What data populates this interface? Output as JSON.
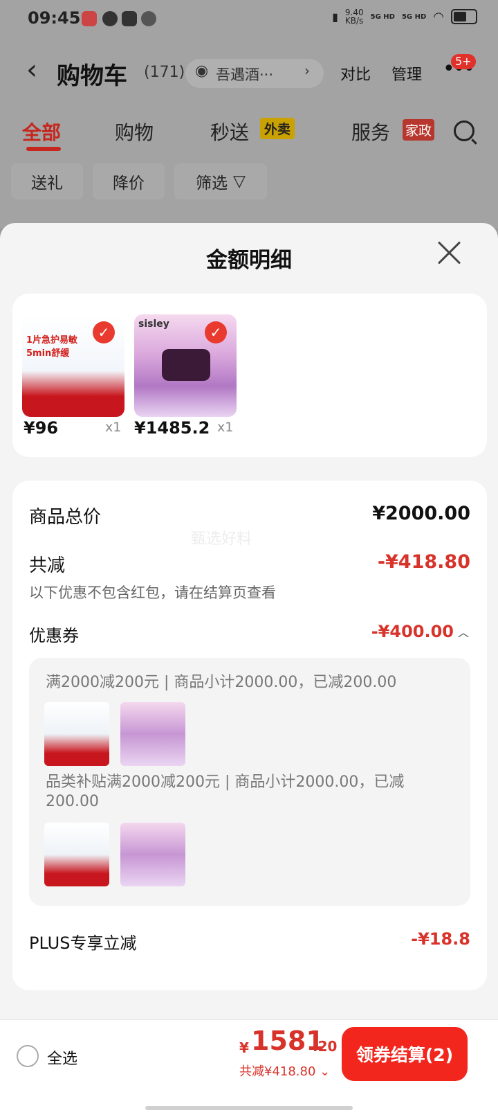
{
  "status_bar": {
    "time": "09:45",
    "net_speed": "9.40\nKB/s",
    "signal1": "5G HD",
    "signal2": "5G HD"
  },
  "header": {
    "title": "购物车",
    "count": "(171)",
    "store": "吾遇酒···",
    "compare": "对比",
    "manage": "管理",
    "badge": "5+"
  },
  "tabs": [
    {
      "label": "全部",
      "active": true
    },
    {
      "label": "购物",
      "active": false
    },
    {
      "label": "秒送",
      "tag": "外卖"
    },
    {
      "label": "服务",
      "tag": "家政"
    }
  ],
  "filter_chips": [
    "送礼",
    "降价",
    "筛选"
  ],
  "sheet": {
    "title": "金额明细",
    "products": [
      {
        "thumb_text": "1片急护易敏\n5min舒缓",
        "price": "¥96",
        "qty": "x1"
      },
      {
        "thumb_text": "sisley",
        "price": "¥1485.2",
        "qty": "x1"
      }
    ],
    "total_label": "商品总价",
    "total_value": "¥2000.00",
    "watermark": "甄选好料",
    "reduce_label": "共减",
    "reduce_value": "-¥418.80",
    "reduce_note": "以下优惠不包含红包，请在结算页查看",
    "coupon_label": "优惠券",
    "coupon_value": "-¥400.00",
    "coupon_chev": "︿",
    "coupon_lines": [
      "满2000减200元 | 商品小计2000.00，已减200.00",
      "品类补贴满2000减200元 | 商品小计2000.00，已减200.00"
    ],
    "plus_label": "PLUS专享立减",
    "plus_value": "-¥18.8"
  },
  "bottom_bar": {
    "select_all": "全选",
    "currency": "¥",
    "total_int": "1581",
    "total_dec": ".20",
    "total_reduce": "共减¥418.80 ⌄",
    "checkout": "领券结算(2)"
  },
  "colors": {
    "accent": "#e0312b",
    "price_red": "#d8332a",
    "checkout_btn": "#f2261d"
  }
}
